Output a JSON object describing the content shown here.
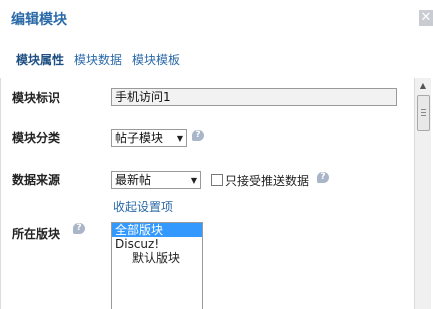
{
  "dialog": {
    "title": "编辑模块",
    "close_glyph": "✕"
  },
  "tabs": [
    {
      "label": "模块属性",
      "active": true
    },
    {
      "label": "模块数据",
      "active": false
    },
    {
      "label": "模块模板",
      "active": false
    }
  ],
  "form": {
    "module_id": {
      "label": "模块标识",
      "value": "手机访问1"
    },
    "module_category": {
      "label": "模块分类",
      "selected": "帖子模块"
    },
    "data_source": {
      "label": "数据来源",
      "selected": "最新帖",
      "checkbox_label": "只接受推送数据",
      "checkbox_checked": false
    },
    "collapse_link": "收起设置项",
    "board": {
      "label": "所在版块",
      "options": [
        {
          "label": "全部版块",
          "selected": true,
          "child": false
        },
        {
          "label": "Discuz!",
          "selected": false,
          "child": false
        },
        {
          "label": "默认版块",
          "selected": false,
          "child": true
        }
      ]
    }
  },
  "icons": {
    "help": "help-bubble-icon",
    "close": "close-icon",
    "dropdown": "chevron-down-icon",
    "scroll_up": "scroll-up-arrow-icon"
  },
  "colors": {
    "title": "#2b6aa8",
    "link": "#2b6aa8",
    "selection": "#3399ff",
    "help_icon": "#a9b5c8"
  }
}
